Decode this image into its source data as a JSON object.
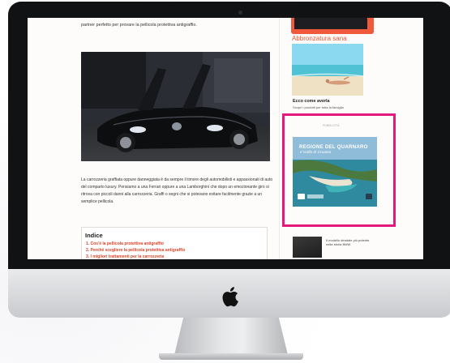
{
  "article": {
    "intro_text": "partner perfetto per provare la pellicola protettiva antigraffio.",
    "body_text": "La carrozzeria graffiata oppure danneggiata è da sempre il timore degli automobilisti e appassionati di auto del comparto luxury. Pensiamo a una Ferrari oppure a una Lamborghini che dopo un emozionante giro si ritrova con piccoli danni alla carrozzeria. Graffi o segni che si potevano evitare facilmente grazie a un semplice pellicola.",
    "toc": {
      "title": "Indice",
      "items": [
        "1. Cos'è la pellicola protettiva antigraffio",
        "2. Perché scegliere la pellicola protettiva antigraffio",
        "3. I migliori trattamenti per la carrozzeria"
      ]
    }
  },
  "sidebar": {
    "heading": "Abbronzatura sana",
    "story_title": "Ecco come averla",
    "story_sub": "Scopri i prodotti per tutta la famiglia",
    "ad": {
      "label": "PUBBLICITÀ",
      "title": "REGIONE DEL QUARNARO",
      "subtitle": "Il Golfo di Croazia"
    },
    "related_text": "Il modello stradale più potente nella storia BMW"
  },
  "colors": {
    "accent": "#e2593a",
    "highlight_frame": "#e4197e",
    "toc_link": "#d6452b"
  }
}
